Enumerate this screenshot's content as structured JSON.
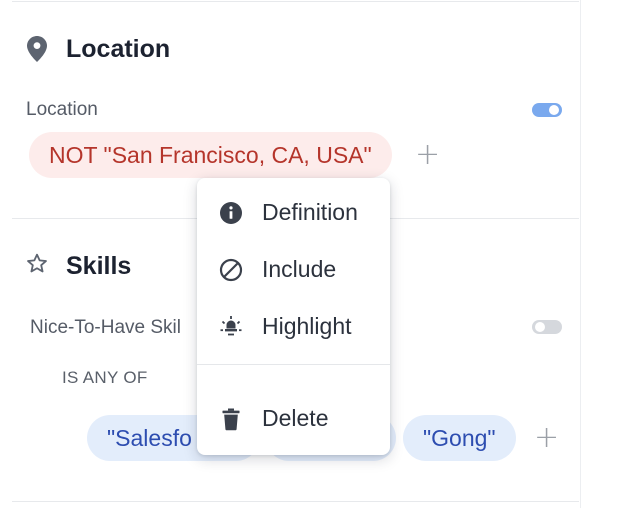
{
  "location_section": {
    "title": "Location",
    "icon": "map-pin-icon",
    "field_label": "Location",
    "toggle_on": true,
    "chips": [
      {
        "text": "NOT \"San Francisco, CA, USA\"",
        "variant": "exclude"
      }
    ]
  },
  "skills_section": {
    "title": "Skills",
    "icon": "star-outline-icon",
    "field_label": "Nice-To-Have Skil",
    "toggle_on": false,
    "operator": "IS ANY OF",
    "chips": [
      {
        "text": "\"Salesfo"
      },
      {
        "text": ""
      },
      {
        "text": "\"Gong\""
      }
    ]
  },
  "add_symbol": "+",
  "context_menu": {
    "items": [
      {
        "label": "Definition",
        "icon": "info-icon"
      },
      {
        "label": "Include",
        "icon": "block-icon"
      },
      {
        "label": "Highlight",
        "icon": "spotlight-icon"
      },
      {
        "label": "Delete",
        "icon": "trash-icon"
      }
    ]
  },
  "colors": {
    "exclude_chip_bg": "#fdeceb",
    "exclude_chip_text": "#b5352b",
    "include_chip_bg": "#e3edfb",
    "include_chip_text": "#2d4db0",
    "toggle_on": "#7aa9ee",
    "toggle_off": "#d5d8dd"
  }
}
